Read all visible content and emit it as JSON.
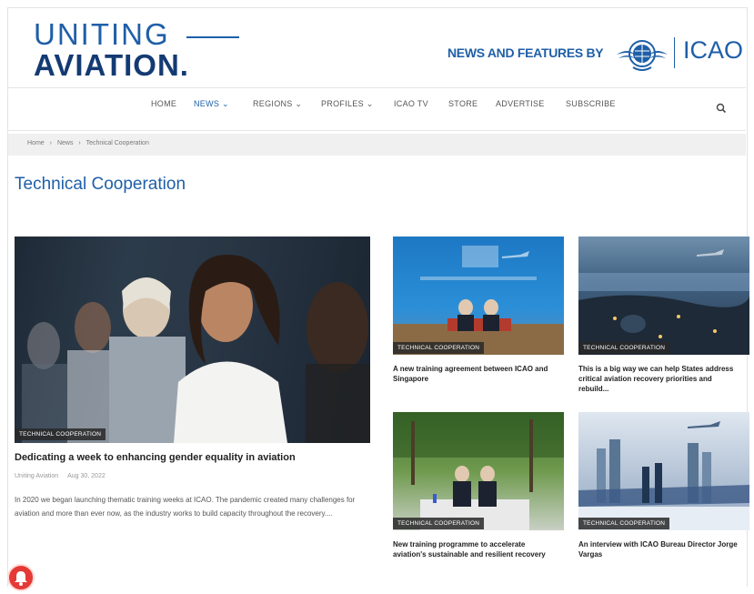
{
  "header": {
    "logo_line1": "UNITING",
    "logo_line2": "AVIATION.",
    "news_by": "NEWS AND FEATURES BY",
    "icao": "ICAO"
  },
  "nav": {
    "items": [
      "HOME",
      "NEWS",
      "REGIONS",
      "PROFILES",
      "ICAO TV",
      "STORE",
      "ADVERTISE",
      "SUBSCRIBE"
    ],
    "active": "NEWS"
  },
  "breadcrumb": {
    "home": "Home",
    "sep": "›",
    "news": "News",
    "current": "Technical Cooperation"
  },
  "page_title": "Technical Cooperation",
  "featured": {
    "badge": "TECHNICAL COOPERATION",
    "title": "Dedicating a week to enhancing gender equality in aviation",
    "author": "Uniting Aviation",
    "date": "Aug 30, 2022",
    "excerpt": "In 2020 we began launching thematic training weeks at ICAO. The pandemic created many challenges for aviation and more than ever now, as the industry works to build capacity throughout the recovery...."
  },
  "cards": [
    {
      "badge": "TECHNICAL COOPERATION",
      "title": "A new training agreement between ICAO and Singapore"
    },
    {
      "badge": "TECHNICAL COOPERATION",
      "title": "This is a big way we can help States address critical aviation recovery priorities and rebuild..."
    },
    {
      "badge": "TECHNICAL COOPERATION",
      "title": "New training programme to accelerate aviation's sustainable and resilient recovery"
    },
    {
      "badge": "TECHNICAL COOPERATION",
      "title": "An interview with ICAO Bureau Director Jorge Vargas"
    }
  ],
  "colors": {
    "brand_blue": "#1f5fa8",
    "brand_navy": "#143a73",
    "badge_bg": "#2a2a2a",
    "notification": "#e53935"
  }
}
